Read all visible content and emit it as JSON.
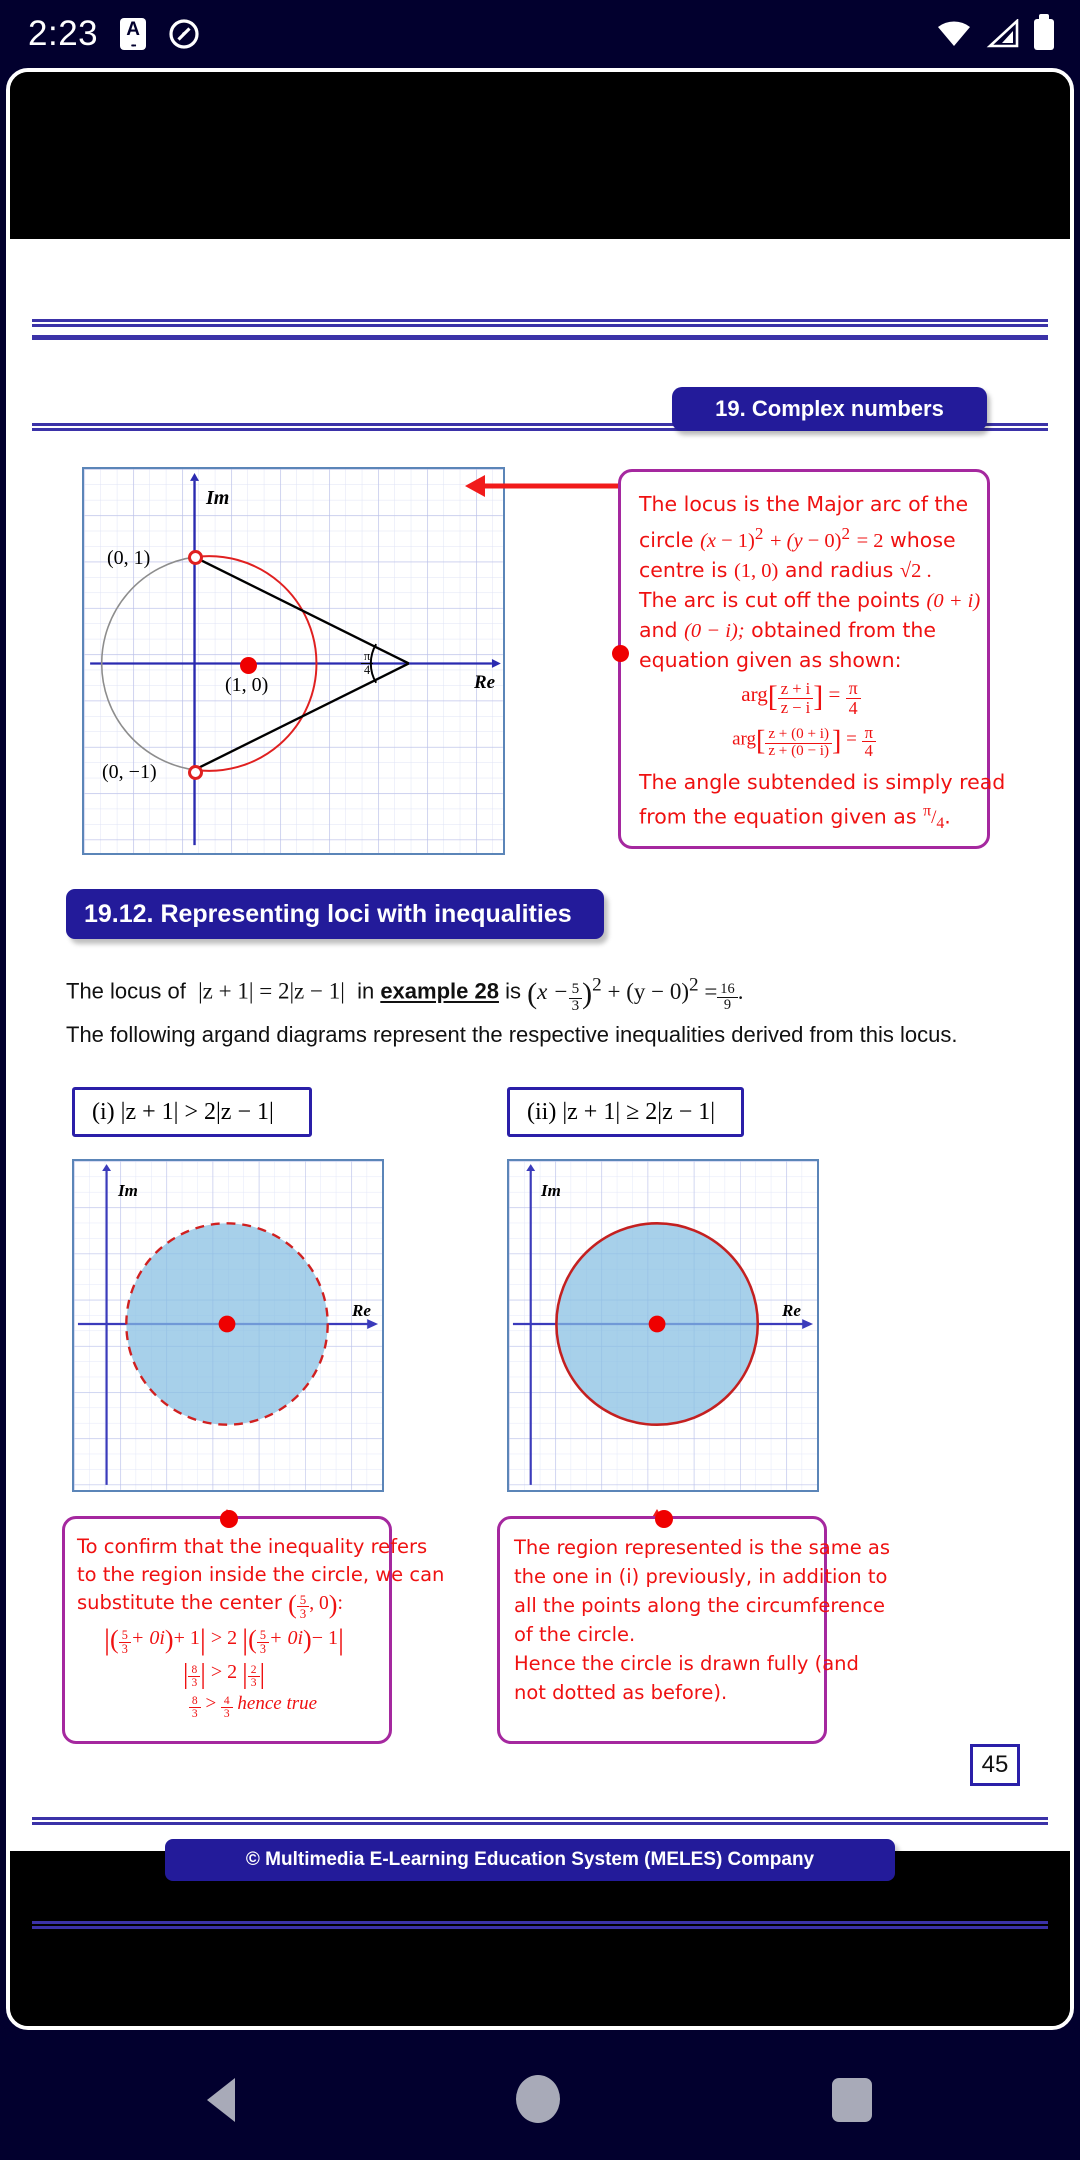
{
  "status_bar": {
    "time": "2:23",
    "icons": [
      "text-badge-icon",
      "no-location-icon",
      "wifi-icon",
      "cellular-signal-icon",
      "battery-icon"
    ]
  },
  "document": {
    "chapter_tab": "19. Complex numbers",
    "section_title": "19.12. Representing loci with inequalities",
    "page_number": "45",
    "footer": "© Multimedia E-Learning Education System (MELES) Company",
    "body": {
      "line1_a": "The locus of",
      "line1_b": "|z + 1| = 2|z − 1|",
      "line1_c": "in",
      "line1_link": "example 28",
      "line1_d": "is",
      "line1_eq_x": "x −",
      "line1_frac_num": "5",
      "line1_frac_den": "3",
      "line1_eq_tail": "+ (y − 0)",
      "line1_eq_eq": "=",
      "line1_res_num": "16",
      "line1_res_den": "9",
      "line2": "The following argand diagrams represent the respective inequalities derived from this locus."
    },
    "inequality_labels": {
      "i": "(i)  |z + 1| > 2|z − 1|",
      "ii": "(ii) |z + 1| ≥ 2|z − 1|"
    },
    "diagram1": {
      "axis_im": "Im",
      "axis_re": "Re",
      "point_top": "(0,  1)",
      "point_bottom": "(0, −1)",
      "point_centre": "(1,  0)",
      "angle_num": "π",
      "angle_den": "4"
    },
    "diagram2": {
      "axis_im": "Im",
      "axis_re": "Re"
    },
    "diagram3": {
      "axis_im": "Im",
      "axis_re": "Re"
    },
    "callout1": {
      "l1": "The locus is the Major arc of the",
      "l2_a": "circle",
      "l2_b": "(x − 1)",
      "l2_c": "+ (y − 0)",
      "l2_d": "= 2",
      "l2_e": "whose",
      "l3_a": "centre is",
      "l3_b": "(1,  0)",
      "l3_c": "and radius",
      "l3_d": "√2 .",
      "l4_a": "The arc is cut off the points",
      "l4_b": "(0 + i)",
      "l5_a": "and",
      "l5_b": "(0 − i);",
      "l5_c": "obtained from the",
      "l6": "equation given as shown:",
      "eq1_arg": "arg",
      "eq1_num": "z + i",
      "eq1_den": "z − i",
      "eq1_eq": "=",
      "eq1_rnum": "π",
      "eq1_rden": "4",
      "eq2_arg": "arg",
      "eq2_num": "z + (0 + i)",
      "eq2_den": "z + (0 − i)",
      "eq2_eq": "=",
      "eq2_rnum": "π",
      "eq2_rden": "4",
      "l7": "The angle subtended is simply read",
      "l8_a": "from the equation given as",
      "l8_pi": "π",
      "l8_four": "4",
      "l8_end": "."
    },
    "callout2": {
      "l1": "To confirm that the inequality refers",
      "l2": "to the region inside the circle, we can",
      "l3_a": "substitute the center",
      "l3_num": "5",
      "l3_den": "3",
      "l3_b": ", 0",
      "l3_c": ":",
      "eq1_num": "5",
      "eq1_den": "3",
      "eq1_a": "+ 0i",
      "eq1_b": "+ 1",
      "eq1_gt": "> 2",
      "eq1_num2": "5",
      "eq1_den2": "3",
      "eq1_c": "+ 0i",
      "eq1_d": "− 1",
      "eq2_num": "8",
      "eq2_den": "3",
      "eq2_gt": "> 2",
      "eq2_num2": "2",
      "eq2_den2": "3",
      "eq3_num": "8",
      "eq3_den": "3",
      "eq3_gt": ">",
      "eq3_num2": "4",
      "eq3_den2": "3",
      "eq3_tail": "hence  true"
    },
    "callout3": {
      "l1": "The region represented is the same as",
      "l2": "the one in (i) previously, in addition to",
      "l3": "all the points along the circumference",
      "l4": "of the circle.",
      "l5": "Hence the circle is drawn fully (and",
      "l6": "not dotted as before)."
    }
  },
  "nav_bar": {
    "back": "back-button",
    "home": "home-button",
    "recents": "recents-button"
  },
  "colors": {
    "accent_blue": "#231b9a",
    "rule_blue": "#3b32a8",
    "callout_border": "#a5289f",
    "callout_text": "#ef1111",
    "shade_fill": "#85bee2",
    "status_bg": "#02002e"
  },
  "chart_data": [
    {
      "type": "scatter",
      "title": "Argand diagram: major arc locus",
      "xlabel": "Re",
      "ylabel": "Im",
      "xlim": [
        -2.2,
        3.2
      ],
      "ylim": [
        -2.4,
        2.4
      ],
      "grid": true,
      "annotations": [
        "(0,  1)",
        "(0, −1)",
        "(1,  0)",
        "π/4"
      ],
      "shapes": [
        {
          "kind": "circle",
          "center": [
            1,
            0
          ],
          "radius": 1.414,
          "stroke": "#d02020",
          "dashed": false
        },
        {
          "kind": "point",
          "at": [
            1,
            0
          ],
          "style": "filled-red"
        },
        {
          "kind": "point",
          "at": [
            0,
            1
          ],
          "style": "open-red"
        },
        {
          "kind": "point",
          "at": [
            0,
            -1
          ],
          "style": "open-red"
        },
        {
          "kind": "segment",
          "from": [
            0,
            1
          ],
          "to": [
            2.414,
            0
          ]
        },
        {
          "kind": "segment",
          "from": [
            0,
            -1
          ],
          "to": [
            2.414,
            0
          ]
        }
      ]
    },
    {
      "type": "scatter",
      "title": "(i) |z + 1| > 2|z − 1|",
      "xlabel": "Re",
      "ylabel": "Im",
      "grid": true,
      "shapes": [
        {
          "kind": "circle",
          "center": [
            1.667,
            0
          ],
          "radius": 1.333,
          "stroke": "#d02020",
          "dashed": true,
          "fill": "#85bee2"
        },
        {
          "kind": "point",
          "at": [
            1.667,
            0
          ],
          "style": "filled-red"
        }
      ]
    },
    {
      "type": "scatter",
      "title": "(ii) |z + 1| ≥ 2|z − 1|",
      "xlabel": "Re",
      "ylabel": "Im",
      "grid": true,
      "shapes": [
        {
          "kind": "circle",
          "center": [
            1.667,
            0
          ],
          "radius": 1.333,
          "stroke": "#d02020",
          "dashed": false,
          "fill": "#85bee2"
        },
        {
          "kind": "point",
          "at": [
            1.667,
            0
          ],
          "style": "filled-red"
        }
      ]
    }
  ]
}
